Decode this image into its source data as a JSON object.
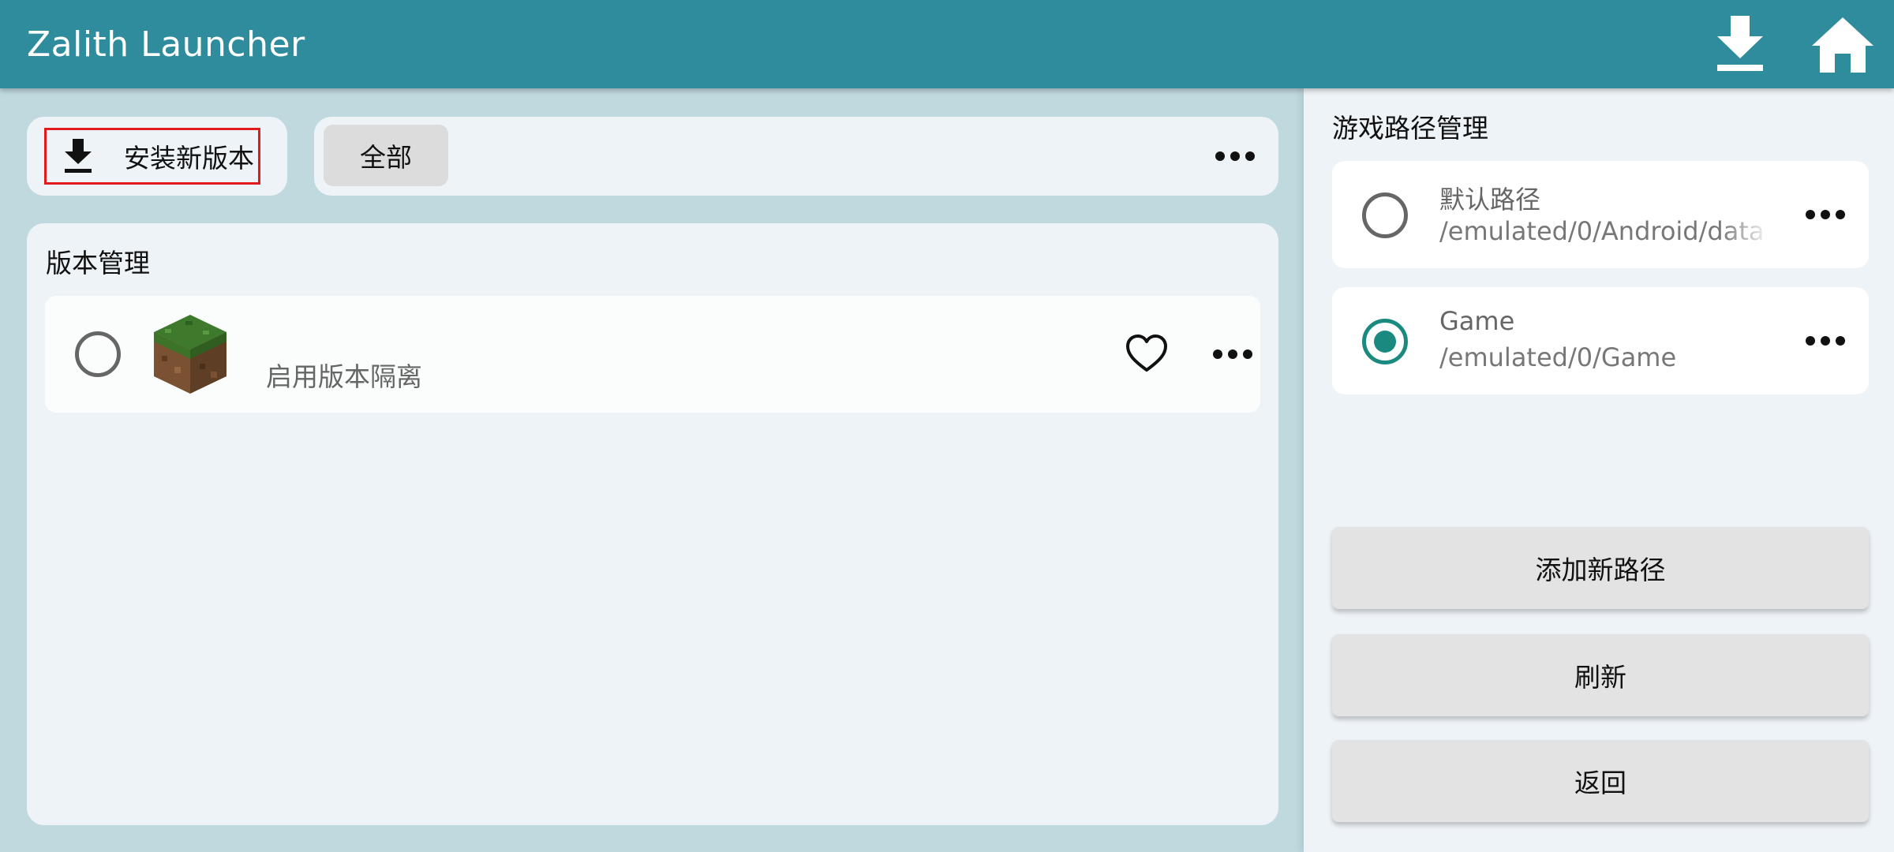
{
  "app": {
    "title": "Zalith Launcher",
    "accent_color": "#2e8c9c"
  },
  "topbar": {
    "icons": [
      "download-icon",
      "home-icon"
    ]
  },
  "install": {
    "label": "安装新版本",
    "icon": "download-icon"
  },
  "filter": {
    "chip_label": "全部",
    "more_icon": "more-horizontal-icon"
  },
  "versions": {
    "title": "版本管理",
    "items": [
      {
        "name": "",
        "subtitle": "启用版本隔离",
        "selected": false,
        "favorite": false,
        "icon": "grass-block-icon"
      }
    ]
  },
  "paths": {
    "title": "游戏路径管理",
    "items": [
      {
        "name": "默认路径",
        "path": "/emulated/0/Android/data",
        "selected": false
      },
      {
        "name": "Game",
        "path": "/emulated/0/Game",
        "selected": true
      }
    ],
    "selected_color": "#1a8a80"
  },
  "actions": {
    "add_path": "添加新路径",
    "refresh": "刷新",
    "back": "返回"
  }
}
